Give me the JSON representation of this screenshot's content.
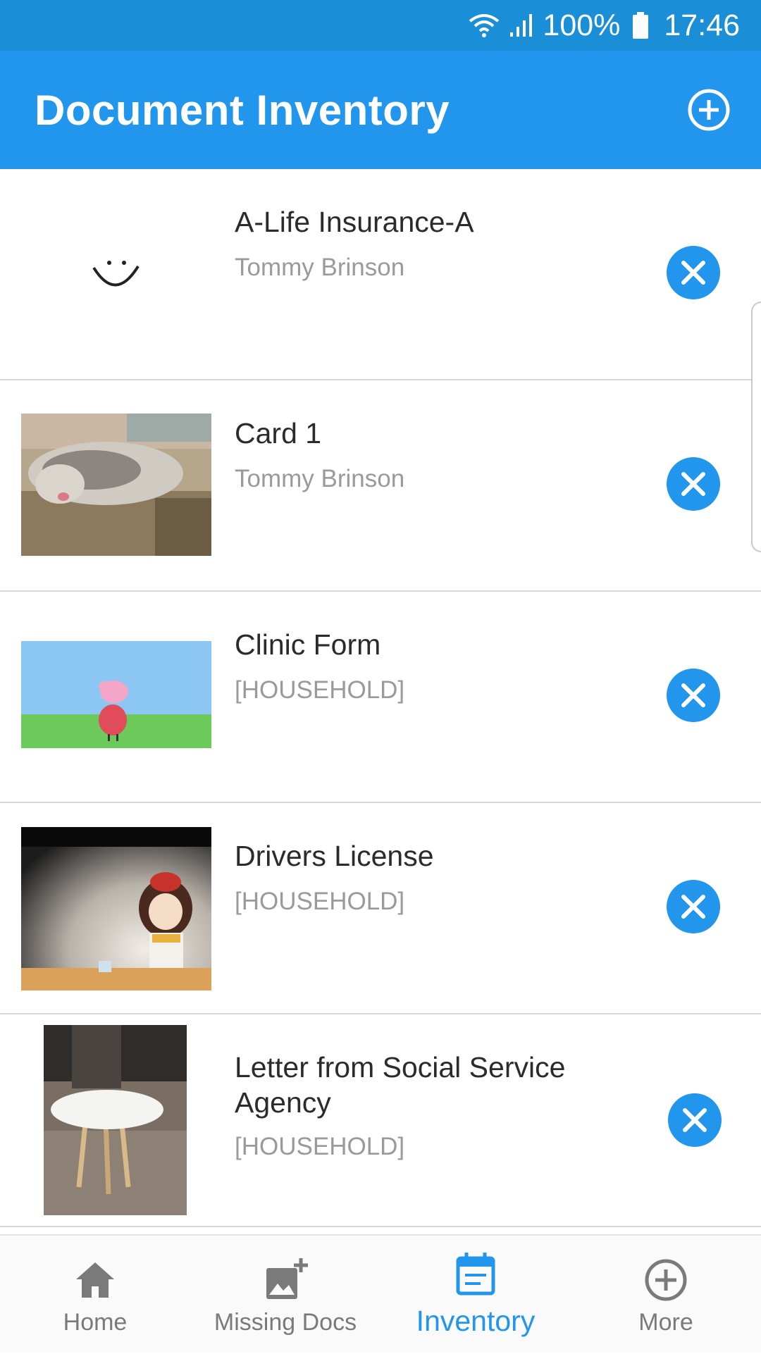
{
  "status_bar": {
    "battery": "100%",
    "time": "17:46"
  },
  "app_bar": {
    "title": "Document Inventory",
    "add_icon": "add-circle-icon"
  },
  "documents": [
    {
      "title": "A-Life Insurance-A",
      "subtitle": "Tommy Brinson",
      "thumbnail": "smiley-sketch"
    },
    {
      "title": "Card 1",
      "subtitle": "Tommy Brinson",
      "thumbnail": "cat-in-box-photo"
    },
    {
      "title": "Clinic Form",
      "subtitle": "[HOUSEHOLD]",
      "thumbnail": "cartoon-pig-on-grass"
    },
    {
      "title": "Drivers License",
      "subtitle": "[HOUSEHOLD]",
      "thumbnail": "illustrated-girl-with-cup"
    },
    {
      "title": "Letter from Social Service Agency",
      "subtitle": "[HOUSEHOLD]",
      "thumbnail": "round-table-photo"
    }
  ],
  "bottom_nav": [
    {
      "label": "Home",
      "icon": "home-icon"
    },
    {
      "label": "Missing Docs",
      "icon": "add-photo-icon"
    },
    {
      "label": "Inventory",
      "icon": "calendar-list-icon",
      "active": true
    },
    {
      "label": "More",
      "icon": "add-circle-outline-icon"
    }
  ],
  "colors": {
    "primary": "#2196ec",
    "status_bar": "#1a8fd8",
    "inactive": "#7a7a7a"
  }
}
